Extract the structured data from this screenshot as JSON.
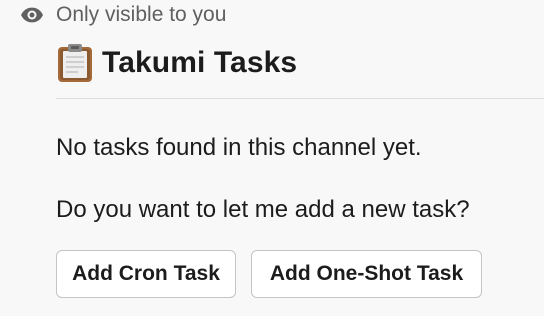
{
  "header": {
    "visibility_label": "Only visible to you",
    "visibility_icon": "eye-icon"
  },
  "card": {
    "icon": "clipboard-icon",
    "title": "Takumi Tasks",
    "messages": [
      "No tasks found in this channel yet.",
      "Do you want to let me add a new task?"
    ],
    "buttons": [
      {
        "label": "Add Cron Task"
      },
      {
        "label": "Add One-Shot Task"
      }
    ]
  },
  "colors": {
    "background": "#f8f8f8",
    "text": "#1d1c1d",
    "muted": "#616061",
    "button_border": "#c4c4c4",
    "clipboard_wood": "#a56a3a",
    "clipboard_clip": "#8a8a8a"
  }
}
